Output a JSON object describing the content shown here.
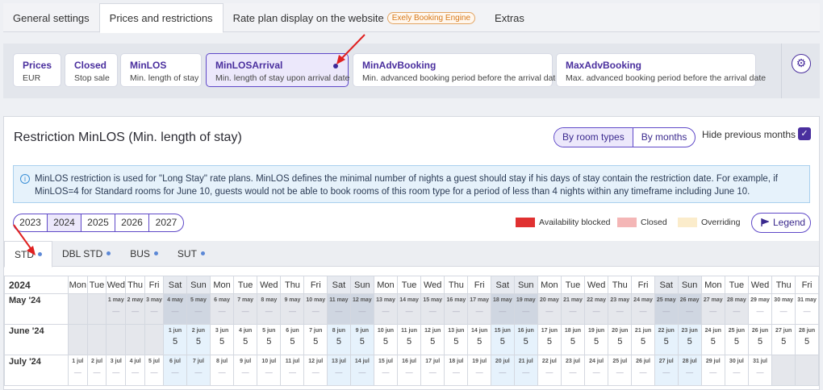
{
  "top_tabs": [
    {
      "label": "General settings"
    },
    {
      "label": "Prices and restrictions"
    },
    {
      "label": "Rate plan display on the website",
      "badge": "Exely Booking Engine"
    },
    {
      "label": "Extras"
    }
  ],
  "cards": [
    {
      "title": "Prices",
      "subtitle": "EUR"
    },
    {
      "title": "Closed",
      "subtitle": "Stop sale"
    },
    {
      "title": "MinLOS",
      "subtitle": "Min. length of stay"
    },
    {
      "title": "MinLOSArrival",
      "subtitle": "Min. length of stay upon arrival date"
    },
    {
      "title": "MinAdvBooking",
      "subtitle": "Min. advanced booking period before the arrival date"
    },
    {
      "title": "MaxAdvBooking",
      "subtitle": "Max. advanced booking period before the arrival date"
    }
  ],
  "panel": {
    "title": "Restriction MinLOS (Min. length of stay)",
    "view_by_room_types": "By room types",
    "view_by_months": "By months",
    "hide_previous_months": "Hide previous months",
    "info": "MinLOS restriction is used for \"Long Stay\" rate plans. MinLOS defines the minimal number of nights a guest should stay if his days of stay contain the restriction date. For example, if MinLOS=4 for Standard rooms for June 10, guests would not be able to book rooms of this room type for a period of less than 4 nights within any timeframe including June 10."
  },
  "years": [
    "2023",
    "2024",
    "2025",
    "2026",
    "2027"
  ],
  "selected_year": "2024",
  "legend": {
    "availability_blocked": "Availability blocked",
    "closed": "Closed",
    "overriding": "Overriding",
    "button": "Legend",
    "colors": {
      "blocked": "#e03131",
      "closed": "#f4b6b6",
      "overriding": "#fbeccb"
    }
  },
  "room_types": [
    "STD",
    "DBL STD",
    "BUS",
    "SUT"
  ],
  "calendar": {
    "year_label": "2024",
    "weekdays": [
      "Mon",
      "Tue",
      "Wed",
      "Thu",
      "Fri",
      "Sat",
      "Sun",
      "Mon",
      "Tue",
      "Wed",
      "Thu",
      "Fri",
      "Sat",
      "Sun",
      "Mon",
      "Tue",
      "Wed",
      "Thu",
      "Fri",
      "Sat",
      "Sun",
      "Mon",
      "Tue",
      "Wed",
      "Thu",
      "Fri",
      "Sat",
      "Sun",
      "Mon",
      "Tue",
      "Wed",
      "Thu",
      "Fri"
    ],
    "empty_mark": "—",
    "months": [
      {
        "label": "May '24",
        "offset": 2,
        "days": 31,
        "suffix": "may",
        "past_until": 28,
        "value": ""
      },
      {
        "label": "June '24",
        "offset": 5,
        "days": 30,
        "suffix": "jun",
        "past_until": 0,
        "value": "5"
      },
      {
        "label": "July '24",
        "offset": 0,
        "days": 31,
        "suffix": "jul",
        "past_until": 0,
        "value": ""
      }
    ]
  },
  "accent_color": "#4a2f9e"
}
